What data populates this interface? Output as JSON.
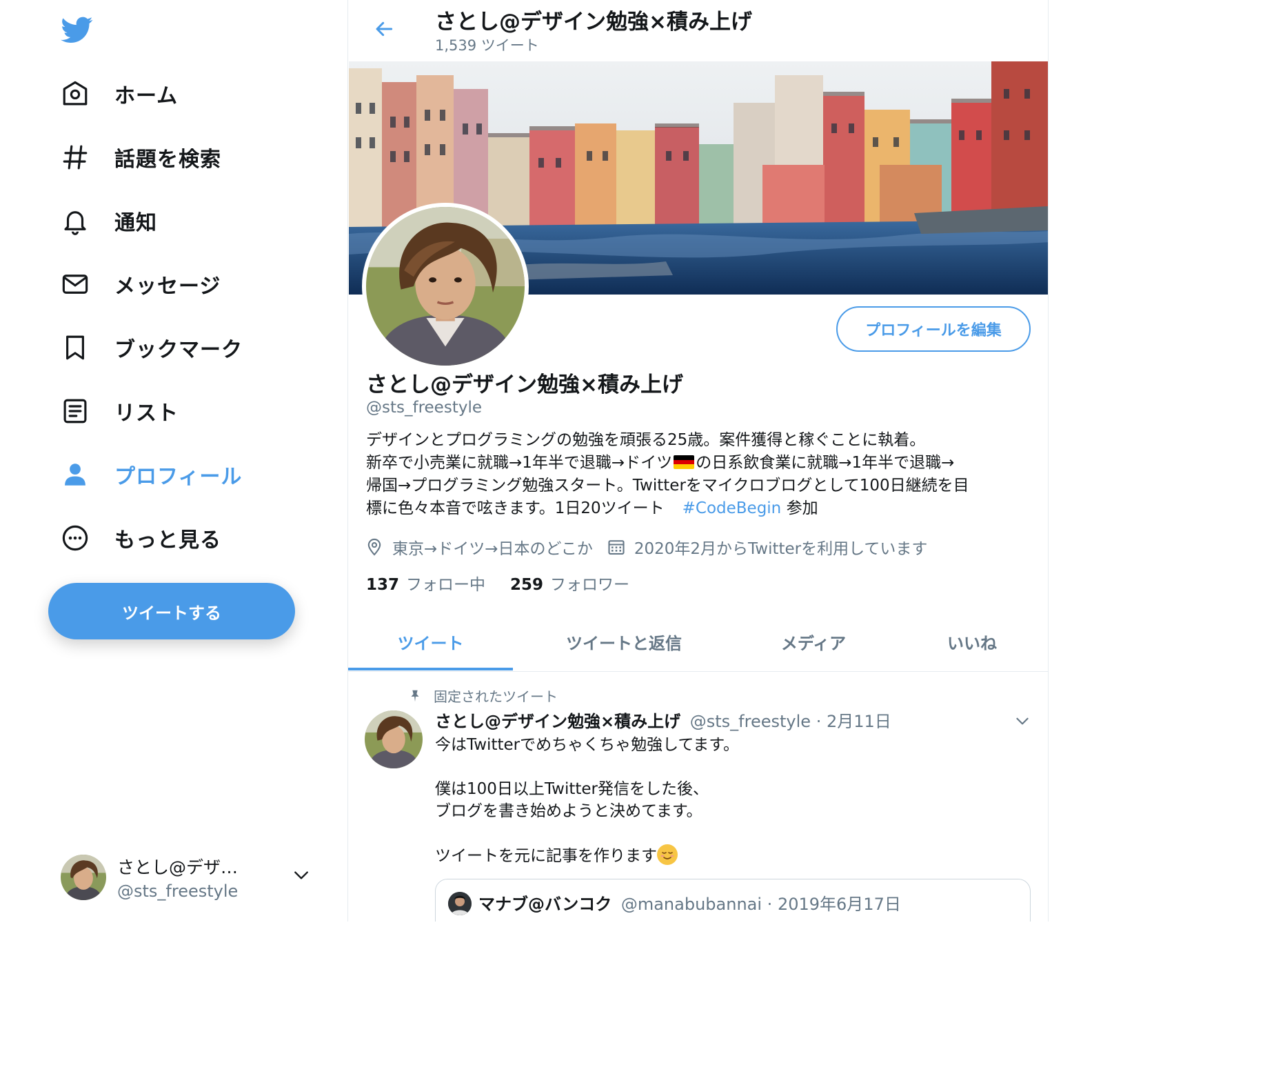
{
  "colors": {
    "accent": "#4a9be8",
    "text": "#14171a",
    "muted": "#657786",
    "border": "#e6ecf0"
  },
  "sidebar": {
    "logo_icon": "twitter-bird-icon",
    "items": [
      {
        "label": "ホーム",
        "icon": "home-icon"
      },
      {
        "label": "話題を検索",
        "icon": "hashtag-icon"
      },
      {
        "label": "通知",
        "icon": "bell-icon"
      },
      {
        "label": "メッセージ",
        "icon": "envelope-icon"
      },
      {
        "label": "ブックマーク",
        "icon": "bookmark-icon"
      },
      {
        "label": "リスト",
        "icon": "list-icon"
      },
      {
        "label": "プロフィール",
        "icon": "person-icon",
        "active": true
      },
      {
        "label": "もっと見る",
        "icon": "more-icon"
      }
    ],
    "tweet_button": "ツイートする",
    "account": {
      "name": "さとし@デザ…",
      "handle": "@sts_freestyle"
    }
  },
  "header": {
    "title": "さとし@デザイン勉強×積み上げ",
    "tweet_count": "1,539 ツイート"
  },
  "profile": {
    "edit_button": "プロフィールを編集",
    "name": "さとし@デザイン勉強×積み上げ",
    "handle": "@sts_freestyle",
    "bio": {
      "line1": "デザインとプログラミングの勉強を頑張る25歳。案件獲得と稼ぐことに執着。",
      "line2a": "新卒で小売業に就職→1年半で退職→ドイツ",
      "line2b": "の日系飲食業に就職→1年半で退職→",
      "line3": "帰国→プログラミング勉強スタート。Twitterをマイクロブログとして100日継続を目",
      "line4": "標に色々本音で呟きます。1日20ツイート",
      "hashtag": "#CodeBegin",
      "line4_suffix": " 参加"
    },
    "location": "東京→ドイツ→日本のどこか",
    "joined": "2020年2月からTwitterを利用しています",
    "following_count": "137",
    "following_label": "フォロー中",
    "followers_count": "259",
    "followers_label": "フォロワー"
  },
  "tabs": [
    {
      "label": "ツイート",
      "active": true
    },
    {
      "label": "ツイートと返信"
    },
    {
      "label": "メディア"
    },
    {
      "label": "いいね"
    }
  ],
  "pinned_tweet": {
    "pinned_label": "固定されたツイート",
    "name": "さとし@デザイン勉強×積み上げ",
    "handle": "@sts_freestyle",
    "separator": "·",
    "date": "2月11日",
    "lines": [
      "今はTwitterでめちゃくちゃ勉強してます。",
      "",
      "僕は100日以上Twitter発信をした後、",
      "ブログを書き始めようと決めてます。",
      "",
      "ツイートを元に記事を作ります"
    ],
    "quote": {
      "name": "マナブ@バンコク",
      "handle": "@manabubannai",
      "separator": "·",
      "date": "2019年6月17日"
    }
  }
}
